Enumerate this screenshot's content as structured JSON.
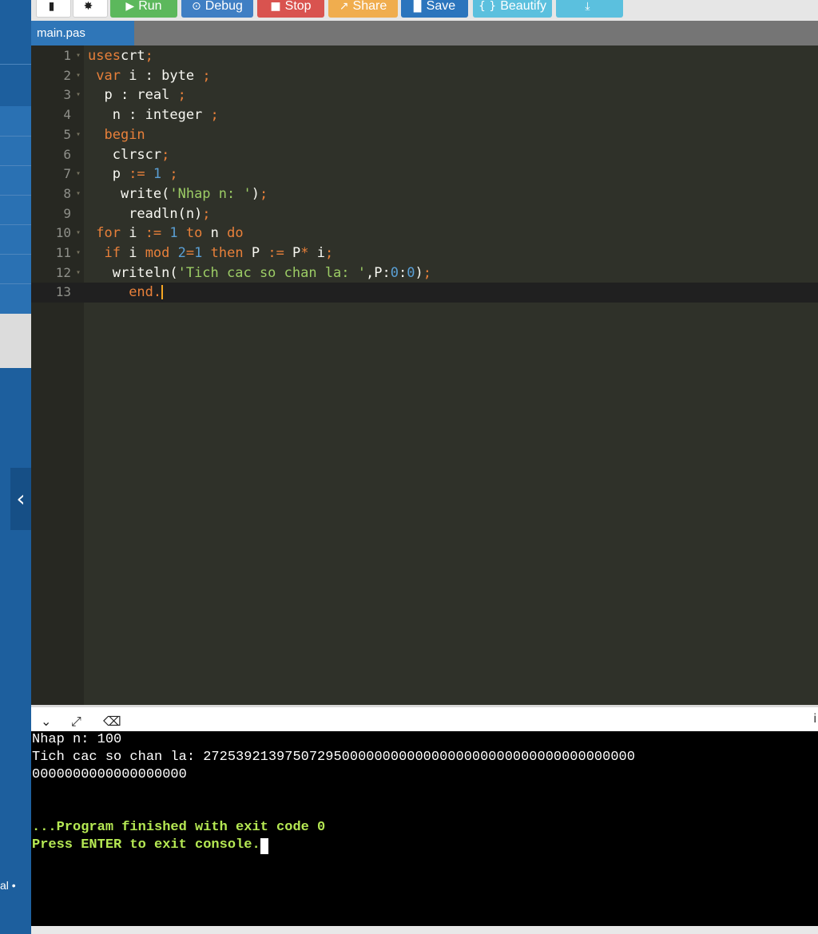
{
  "toolbar": {
    "buttons": [
      {
        "id": "new",
        "label": "",
        "icon": "file-icon",
        "glyph": "▮",
        "color": "#ffffff"
      },
      {
        "id": "open",
        "label": "",
        "icon": "gear-icon",
        "glyph": "✸",
        "color": "#ffffff"
      },
      {
        "id": "run",
        "label": "Run",
        "icon": "play-icon",
        "glyph": "▶",
        "color": "#5cb85c"
      },
      {
        "id": "debug",
        "label": "Debug",
        "icon": "debug-icon",
        "glyph": "⊙",
        "color": "#3f7fc4"
      },
      {
        "id": "stop",
        "label": "Stop",
        "icon": "stop-icon",
        "glyph": "■",
        "color": "#d9534f"
      },
      {
        "id": "share",
        "label": "Share",
        "icon": "share-icon",
        "glyph": "↗",
        "color": "#f0ad4e"
      },
      {
        "id": "save",
        "label": "Save",
        "icon": "save-icon",
        "glyph": "▉",
        "color": "#2b75bd"
      },
      {
        "id": "beautify",
        "label": "Beautify",
        "icon": "braces-icon",
        "glyph": "{ }",
        "color": "#5bc0de"
      },
      {
        "id": "download",
        "label": "",
        "icon": "download-icon",
        "glyph": "⤓",
        "color": "#5bc0de"
      }
    ]
  },
  "tabs": [
    {
      "label": "main.pas",
      "active": true
    }
  ],
  "editor": {
    "cursor_line": 13,
    "lines": [
      {
        "n": "1",
        "fold": true,
        "tokens": [
          [
            "kw",
            "uses"
          ],
          [
            "",
            "crt"
          ],
          [
            "op",
            ";"
          ]
        ]
      },
      {
        "n": "2",
        "fold": true,
        "tokens": [
          [
            "",
            " "
          ],
          [
            "kw",
            "var"
          ],
          [
            "",
            " i : byte "
          ],
          [
            "op",
            ";"
          ]
        ]
      },
      {
        "n": "3",
        "fold": true,
        "tokens": [
          [
            "",
            "  p : real "
          ],
          [
            "op",
            ";"
          ]
        ]
      },
      {
        "n": "4",
        "fold": false,
        "tokens": [
          [
            "",
            "   n : integer "
          ],
          [
            "op",
            ";"
          ]
        ]
      },
      {
        "n": "5",
        "fold": true,
        "tokens": [
          [
            "",
            "  "
          ],
          [
            "kw",
            "begin"
          ]
        ]
      },
      {
        "n": "6",
        "fold": false,
        "tokens": [
          [
            "",
            "   clrscr"
          ],
          [
            "op",
            ";"
          ]
        ]
      },
      {
        "n": "7",
        "fold": true,
        "tokens": [
          [
            "",
            "   p "
          ],
          [
            "op",
            ":="
          ],
          [
            "",
            " "
          ],
          [
            "num",
            "1"
          ],
          [
            "",
            " "
          ],
          [
            "op",
            ";"
          ]
        ]
      },
      {
        "n": "8",
        "fold": true,
        "tokens": [
          [
            "",
            "    write("
          ],
          [
            "str",
            "'Nhap n: '"
          ],
          [
            "",
            ")"
          ],
          [
            "op",
            ";"
          ]
        ]
      },
      {
        "n": "9",
        "fold": false,
        "tokens": [
          [
            "",
            "     readln(n)"
          ],
          [
            "op",
            ";"
          ]
        ]
      },
      {
        "n": "10",
        "fold": true,
        "tokens": [
          [
            "",
            " "
          ],
          [
            "kw",
            "for"
          ],
          [
            "",
            " i "
          ],
          [
            "op",
            ":="
          ],
          [
            "",
            " "
          ],
          [
            "num",
            "1"
          ],
          [
            "",
            " "
          ],
          [
            "kw",
            "to"
          ],
          [
            "",
            " n "
          ],
          [
            "kw",
            "do"
          ]
        ]
      },
      {
        "n": "11",
        "fold": true,
        "tokens": [
          [
            "",
            "  "
          ],
          [
            "kw",
            "if"
          ],
          [
            "",
            " i "
          ],
          [
            "kw",
            "mod"
          ],
          [
            "",
            " "
          ],
          [
            "num",
            "2"
          ],
          [
            "op",
            "="
          ],
          [
            "num",
            "1"
          ],
          [
            "",
            " "
          ],
          [
            "kw",
            "then"
          ],
          [
            "",
            " P "
          ],
          [
            "op",
            ":="
          ],
          [
            "",
            " P"
          ],
          [
            "op",
            "*"
          ],
          [
            "",
            " i"
          ],
          [
            "op",
            ";"
          ]
        ]
      },
      {
        "n": "12",
        "fold": true,
        "tokens": [
          [
            "",
            "   writeln("
          ],
          [
            "str",
            "'Tich cac so chan la: '"
          ],
          [
            "",
            ",P:"
          ],
          [
            "num",
            "0"
          ],
          [
            "",
            ":"
          ],
          [
            "num",
            "0"
          ],
          [
            "",
            ")"
          ],
          [
            "op",
            ";"
          ]
        ]
      },
      {
        "n": "13",
        "fold": false,
        "tokens": [
          [
            "",
            "     "
          ],
          [
            "kw",
            "end."
          ]
        ]
      }
    ]
  },
  "console_header": {
    "icons": [
      {
        "name": "chevron-down-icon",
        "glyph": "⌄"
      },
      {
        "name": "expand-icon",
        "glyph": "⤢"
      },
      {
        "name": "clear-console-icon",
        "glyph": "⌫"
      }
    ],
    "right_text": "i"
  },
  "console": {
    "lines": [
      {
        "text": "Nhap n: 100",
        "style": "white"
      },
      {
        "text": "Tich cac so chan la: 27253921397507295000000000000000000000000000000000000",
        "style": "white"
      },
      {
        "text": "0000000000000000000",
        "style": "white"
      },
      {
        "text": "",
        "style": "white"
      },
      {
        "text": "",
        "style": "white"
      },
      {
        "text": "...Program finished with exit code 0",
        "style": "green"
      },
      {
        "text": "Press ENTER to exit console.",
        "style": "green",
        "cursor": true
      }
    ]
  },
  "sidebar": {
    "collapse_glyph": "‹",
    "bottom_text": "al •"
  },
  "colors": {
    "editor_bg": "#2f3129",
    "gutter_bg": "#272822",
    "keyword": "#e8803a",
    "number": "#5a9fd4",
    "string": "#9ccc65",
    "console_green": "#b5e853"
  }
}
